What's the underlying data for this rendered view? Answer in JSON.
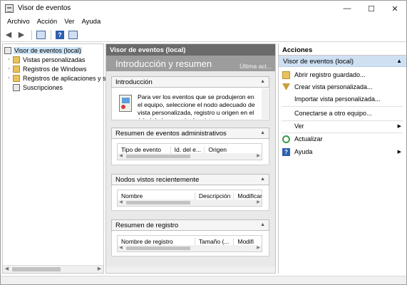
{
  "window": {
    "title": "Visor de eventos",
    "minimize": "—",
    "maximize": "☐",
    "close": "✕"
  },
  "menu": [
    "Archivo",
    "Acción",
    "Ver",
    "Ayuda"
  ],
  "tree": {
    "root": "Visor de eventos (local)",
    "items": [
      "Vistas personalizadas",
      "Registros de Windows",
      "Registros de aplicaciones y s",
      "Suscripciones"
    ]
  },
  "center": {
    "header": "Visor de eventos (local)",
    "banner_title": "Introducción y resumen",
    "banner_right": "Última act...",
    "sections": {
      "intro": {
        "title": "Introducción",
        "text": "Para ver los eventos que se produjeron en el equipo, seleccione el nodo adecuado de vista personalizada, registro u origen en el árbol de la consola. La vista"
      },
      "admin": {
        "title": "Resumen de eventos administrativos",
        "columns": [
          "Tipo de evento",
          "Id. del e...",
          "Origen"
        ]
      },
      "recent": {
        "title": "Nodos vistos recientemente",
        "columns": [
          "Nombre",
          "Descripción",
          "Modificar"
        ]
      },
      "logs": {
        "title": "Resumen de registro",
        "columns": [
          "Nombre de registro",
          "Tamaño (...",
          "Modifi"
        ]
      }
    }
  },
  "actions": {
    "header": "Acciones",
    "group": "Visor de eventos (local)",
    "items": [
      {
        "label": "Abrir registro guardado...",
        "icon": "folder-open-icon"
      },
      {
        "label": "Crear vista personalizada...",
        "icon": "filter-icon"
      },
      {
        "label": "Importar vista personalizada...",
        "icon": ""
      },
      {
        "label": "Conectarse a otro equipo...",
        "icon": ""
      },
      {
        "label": "Ver",
        "icon": "",
        "submenu": true
      },
      {
        "label": "Actualizar",
        "icon": "refresh-icon"
      },
      {
        "label": "Ayuda",
        "icon": "help-icon",
        "submenu": true
      }
    ]
  }
}
